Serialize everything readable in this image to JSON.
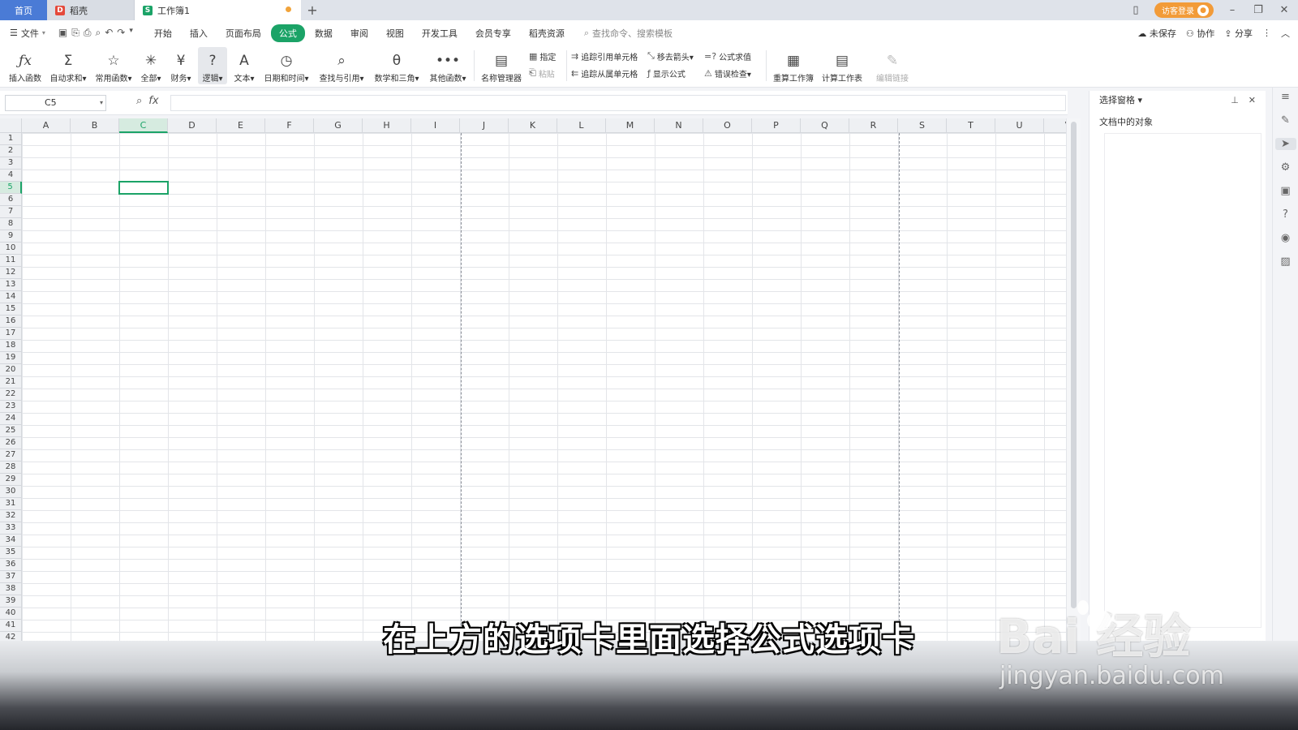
{
  "titlebar": {
    "tabs": [
      {
        "label": "首页"
      },
      {
        "label": "稻壳"
      },
      {
        "label": "工作簿1"
      }
    ],
    "new_tab": "+",
    "visitor_login": "访客登录"
  },
  "menubar": {
    "file": "文件",
    "tabs": [
      "开始",
      "插入",
      "页面布局",
      "公式",
      "数据",
      "审阅",
      "视图",
      "开发工具",
      "会员专享",
      "稻壳资源"
    ],
    "active_tab": "公式",
    "search_placeholder": "查找命令、搜索模板",
    "unsaved": "未保存",
    "collab": "协作",
    "share": "分享"
  },
  "ribbon": {
    "insert_function": "插入函数",
    "autosum": "自动求和",
    "common": "常用函数",
    "all": "全部",
    "finance": "财务",
    "logic": "逻辑",
    "text": "文本",
    "datetime": "日期和时间",
    "lookup": "查找与引用",
    "math": "数学和三角",
    "other": "其他函数",
    "name_manager": "名称管理器",
    "specify": "指定",
    "paste": "粘贴",
    "trace_precedents": "追踪引用单元格",
    "trace_dependents": "追踪从属单元格",
    "remove_arrows": "移去箭头",
    "show_formulas": "显示公式",
    "eval_formula": "公式求值",
    "error_check": "错误检查",
    "recalc_book": "重算工作簿",
    "calc_sheet": "计算工作表",
    "edit_links": "编辑链接"
  },
  "formulabar": {
    "cell_ref": "C5",
    "fx": "fx"
  },
  "grid": {
    "columns": [
      "A",
      "B",
      "C",
      "D",
      "E",
      "F",
      "G",
      "H",
      "I",
      "J",
      "K",
      "L",
      "M",
      "N",
      "O",
      "P",
      "Q",
      "R",
      "S",
      "T",
      "U",
      "V"
    ],
    "rows": [
      "1",
      "2",
      "3",
      "4",
      "5",
      "6",
      "7",
      "8",
      "9",
      "10",
      "11",
      "12",
      "13",
      "14",
      "15",
      "16",
      "17",
      "18",
      "19",
      "20",
      "21",
      "22",
      "23",
      "24",
      "25",
      "26",
      "27",
      "28",
      "29",
      "30",
      "31",
      "32",
      "33",
      "34",
      "35",
      "36",
      "37",
      "38",
      "39",
      "40",
      "41",
      "42"
    ],
    "selected_col": "C",
    "selected_row": "5"
  },
  "sidepanel": {
    "title": "选择窗格",
    "subtitle": "文档中的对象"
  },
  "caption": "在上方的选项卡里面选择公式选项卡",
  "watermark": {
    "brand": "Bai  经验",
    "url": "jingyan.baidu.com"
  },
  "colors": {
    "accent": "#1ba367",
    "home_tab": "#4a7bd6",
    "visitor": "#f29b38"
  }
}
